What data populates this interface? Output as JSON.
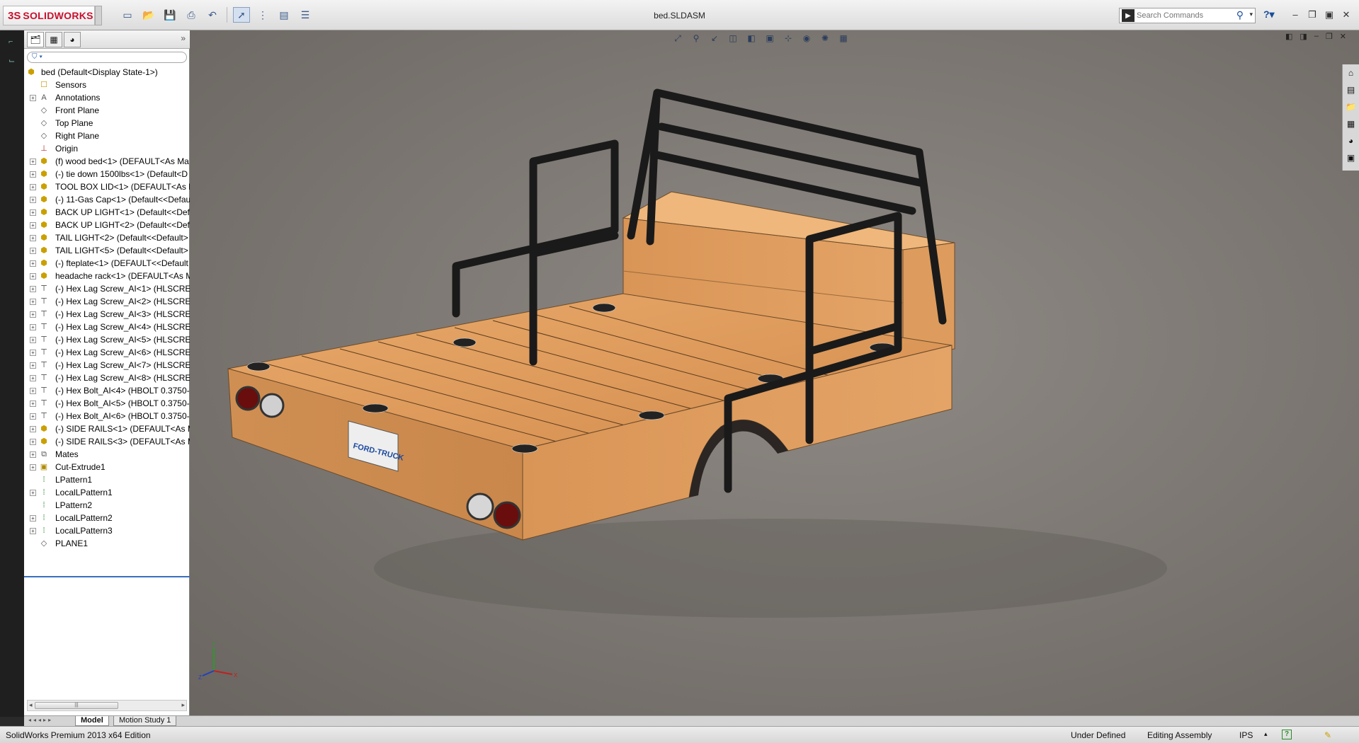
{
  "app": {
    "brand": "SOLIDWORKS",
    "brand_prefix": "3S",
    "document_title": "bed.SLDASM"
  },
  "search": {
    "placeholder": "Search Commands"
  },
  "feature_tree": {
    "root": "bed  (Default<Display State-1>)",
    "items": [
      {
        "label": "Sensors",
        "icon": "sensor-folder-icon",
        "expandable": false
      },
      {
        "label": "Annotations",
        "icon": "annotations-icon",
        "expandable": true
      },
      {
        "label": "Front Plane",
        "icon": "plane-icon",
        "expandable": false
      },
      {
        "label": "Top Plane",
        "icon": "plane-icon",
        "expandable": false
      },
      {
        "label": "Right Plane",
        "icon": "plane-icon",
        "expandable": false
      },
      {
        "label": "Origin",
        "icon": "origin-icon",
        "expandable": false
      },
      {
        "label": "(f) wood bed<1> (DEFAULT<As Ma",
        "icon": "part-icon",
        "expandable": true
      },
      {
        "label": "(-) tie down 1500lbs<1> (Default<D",
        "icon": "part-icon",
        "expandable": true
      },
      {
        "label": "TOOL BOX LID<1> (DEFAULT<As M",
        "icon": "part-icon",
        "expandable": true
      },
      {
        "label": "(-) 11-Gas Cap<1> (Default<<Defau",
        "icon": "part-icon",
        "expandable": true
      },
      {
        "label": "BACK UP LIGHT<1> (Default<<Defa",
        "icon": "part-icon",
        "expandable": true
      },
      {
        "label": "BACK UP LIGHT<2> (Default<<Defa",
        "icon": "part-icon",
        "expandable": true
      },
      {
        "label": "TAIL LIGHT<2> (Default<<Default>",
        "icon": "part-icon",
        "expandable": true
      },
      {
        "label": "TAIL LIGHT<5> (Default<<Default>",
        "icon": "part-icon",
        "expandable": true
      },
      {
        "label": "(-) fteplate<1> (DEFAULT<<Default",
        "icon": "part-icon",
        "expandable": true
      },
      {
        "label": "headache rack<1> (DEFAULT<As M",
        "icon": "part-icon",
        "expandable": true
      },
      {
        "label": "(-) Hex Lag Screw_AI<1> (HLSCREW",
        "icon": "screw-icon",
        "expandable": true
      },
      {
        "label": "(-) Hex Lag Screw_AI<2> (HLSCREW",
        "icon": "screw-icon",
        "expandable": true
      },
      {
        "label": "(-) Hex Lag Screw_AI<3> (HLSCREW",
        "icon": "screw-icon",
        "expandable": true
      },
      {
        "label": "(-) Hex Lag Screw_AI<4> (HLSCREW",
        "icon": "screw-icon",
        "expandable": true
      },
      {
        "label": "(-) Hex Lag Screw_AI<5> (HLSCREW",
        "icon": "screw-icon",
        "expandable": true
      },
      {
        "label": "(-) Hex Lag Screw_AI<6> (HLSCREW",
        "icon": "screw-icon",
        "expandable": true
      },
      {
        "label": "(-) Hex Lag Screw_AI<7> (HLSCREW",
        "icon": "screw-icon",
        "expandable": true
      },
      {
        "label": "(-) Hex Lag Screw_AI<8> (HLSCREW",
        "icon": "screw-icon",
        "expandable": true
      },
      {
        "label": "(-) Hex Bolt_AI<4> (HBOLT 0.3750-1",
        "icon": "screw-icon",
        "expandable": true
      },
      {
        "label": "(-) Hex Bolt_AI<5> (HBOLT 0.3750-1",
        "icon": "screw-icon",
        "expandable": true
      },
      {
        "label": "(-) Hex Bolt_AI<6> (HBOLT 0.3750-1",
        "icon": "screw-icon",
        "expandable": true
      },
      {
        "label": "(-) SIDE RAILS<1> (DEFAULT<As Ma",
        "icon": "part-icon",
        "expandable": true
      },
      {
        "label": "(-) SIDE RAILS<3> (DEFAULT<As Ma",
        "icon": "part-icon",
        "expandable": true
      },
      {
        "label": "Mates",
        "icon": "mates-icon",
        "expandable": true
      },
      {
        "label": "Cut-Extrude1",
        "icon": "cut-extrude-icon",
        "expandable": true
      },
      {
        "label": "LPattern1",
        "icon": "pattern-icon",
        "expandable": false
      },
      {
        "label": "LocalLPattern1",
        "icon": "pattern-icon",
        "expandable": true
      },
      {
        "label": "LPattern2",
        "icon": "pattern-icon",
        "expandable": false
      },
      {
        "label": "LocalLPattern2",
        "icon": "pattern-icon",
        "expandable": true
      },
      {
        "label": "LocalLPattern3",
        "icon": "pattern-icon",
        "expandable": true
      },
      {
        "label": "PLANE1",
        "icon": "plane-icon",
        "expandable": false
      }
    ]
  },
  "bottom_tabs": {
    "model": "Model",
    "motion": "Motion Study 1"
  },
  "status": {
    "edition": "SolidWorks Premium 2013 x64 Edition",
    "definition": "Under Defined",
    "mode": "Editing Assembly",
    "units": "IPS"
  },
  "scene": {
    "plate_text": "FORD-TRUCK"
  },
  "colors": {
    "wood": "#d9975a",
    "rack": "#1c1c1c",
    "accent": "#c8102e",
    "background": "#7b7671"
  }
}
